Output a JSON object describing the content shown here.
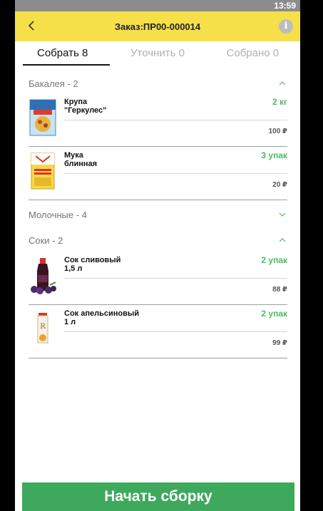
{
  "status": {
    "time": "13:59"
  },
  "header": {
    "title": "Заказ:ПР00-000014"
  },
  "tabs": [
    {
      "label": "Собрать 8"
    },
    {
      "label": "Уточнить 0"
    },
    {
      "label": "Собрано 0"
    }
  ],
  "groups": [
    {
      "label": "Бакалея - 2",
      "items": [
        {
          "name": "Крупа\n\"Геркулес\"",
          "qty": "2 кг",
          "price": "100 ₽"
        },
        {
          "name": "Мука\nблинная",
          "qty": "3 упак",
          "price": "20 ₽"
        }
      ]
    },
    {
      "label": "Молочные - 4"
    },
    {
      "label": "Соки - 2",
      "items": [
        {
          "name": "Сок сливовый\n1,5 л",
          "qty": "2 упак",
          "price": "88 ₽"
        },
        {
          "name": "Сок апельсиновый\n1 л",
          "qty": "2 упак",
          "price": "99 ₽"
        }
      ]
    }
  ],
  "footer": {
    "start_label": "Начать сборку"
  },
  "colors": {
    "accent": "#f5e04a",
    "green": "#4cbb5e",
    "button": "#3ea95c"
  }
}
